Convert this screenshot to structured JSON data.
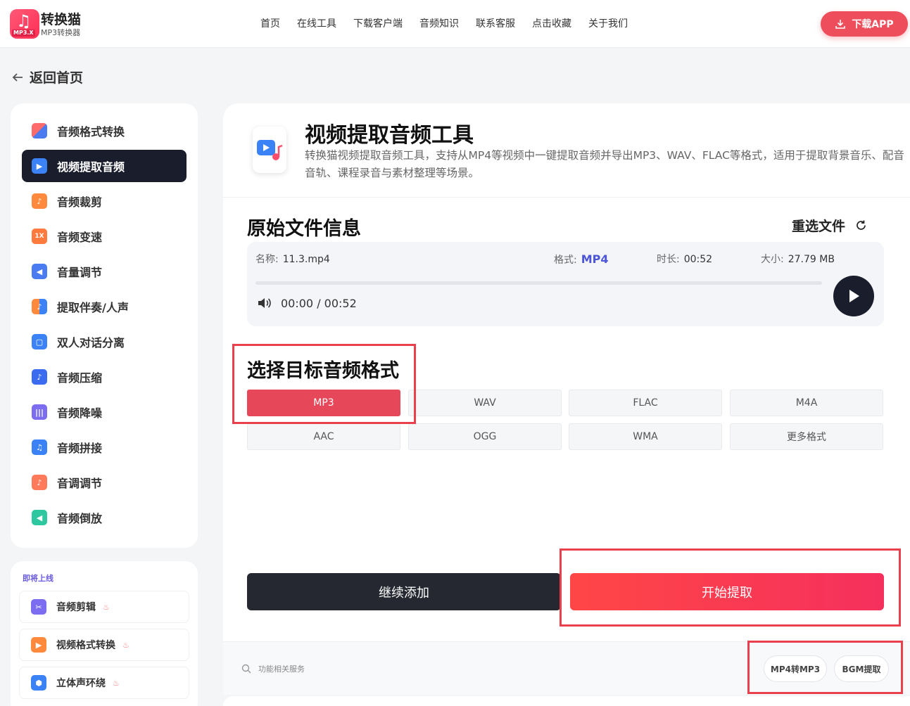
{
  "header": {
    "logo_name": "转换猫",
    "logo_sub": "MP3转换器",
    "logo_tag": "MP3.X",
    "nav": [
      "首页",
      "在线工具",
      "下载客户端",
      "音频知识",
      "联系客服",
      "点击收藏",
      "关于我们"
    ],
    "download_label": "下载APP"
  },
  "back_label": "返回首页",
  "sidebar": {
    "items": [
      {
        "label": "音频格式转换",
        "icon": "format-convert-icon",
        "color": "#ff6b6b"
      },
      {
        "label": "视频提取音频",
        "icon": "video-audio-icon",
        "color": "#3b82f6"
      },
      {
        "label": "音频裁剪",
        "icon": "audio-cut-icon",
        "color": "#ff8a3d"
      },
      {
        "label": "音频变速",
        "icon": "audio-speed-icon",
        "color": "#ff7a3d"
      },
      {
        "label": "音量调节",
        "icon": "volume-icon",
        "color": "#4a7bf0"
      },
      {
        "label": "提取伴奏/人声",
        "icon": "vocal-extract-icon",
        "color": "#ff8a3d"
      },
      {
        "label": "双人对话分离",
        "icon": "dialogue-icon",
        "color": "#3b82f6"
      },
      {
        "label": "音频压缩",
        "icon": "compress-icon",
        "color": "#3b6cf0"
      },
      {
        "label": "音频降噪",
        "icon": "denoise-icon",
        "color": "#7b6cf0"
      },
      {
        "label": "音频拼接",
        "icon": "merge-icon",
        "color": "#3b82f6"
      },
      {
        "label": "音调调节",
        "icon": "pitch-icon",
        "color": "#ff7a5a"
      },
      {
        "label": "音频倒放",
        "icon": "reverse-icon",
        "color": "#2fc7a0"
      }
    ]
  },
  "soon": {
    "title": "即将上线",
    "items": [
      {
        "label": "音频剪辑",
        "icon": "scissors-icon",
        "color": "#7b6cf0"
      },
      {
        "label": "视频格式转换",
        "icon": "video-play-icon",
        "color": "#ff8a3d"
      },
      {
        "label": "立体声环绕",
        "icon": "surround-icon",
        "color": "#3b82f6"
      }
    ]
  },
  "tool": {
    "title": "视频提取音频工具",
    "description": "转换猫视频提取音频工具，支持从MP4等视频中一键提取音频并导出MP3、WAV、FLAC等格式，适用于提取背景音乐、配音音轨、课程录音与素材整理等场景。"
  },
  "file_info": {
    "section_title": "原始文件信息",
    "reselect_label": "重选文件",
    "name_label": "名称:",
    "name_value": "11.3.mp4",
    "format_label": "格式:",
    "format_value": "MP4",
    "duration_label": "时长:",
    "duration_value": "00:52",
    "size_label": "大小:",
    "size_value": "27.79 MB",
    "time_display": "00:00 / 00:52",
    "progress": 0
  },
  "format_select": {
    "section_title": "选择目标音频格式",
    "options": [
      "MP3",
      "WAV",
      "FLAC",
      "M4A",
      "AAC",
      "OGG",
      "WMA",
      "更多格式"
    ],
    "selected": "MP3"
  },
  "actions": {
    "add_label": "继续添加",
    "start_label": "开始提取"
  },
  "service": {
    "label": "功能相关服务",
    "tags": [
      "MP4转MP3",
      "BGM提取"
    ]
  },
  "colors": {
    "accent": "#e6485a",
    "dark": "#1a1d2b",
    "highlight_box": "#e8414d"
  }
}
